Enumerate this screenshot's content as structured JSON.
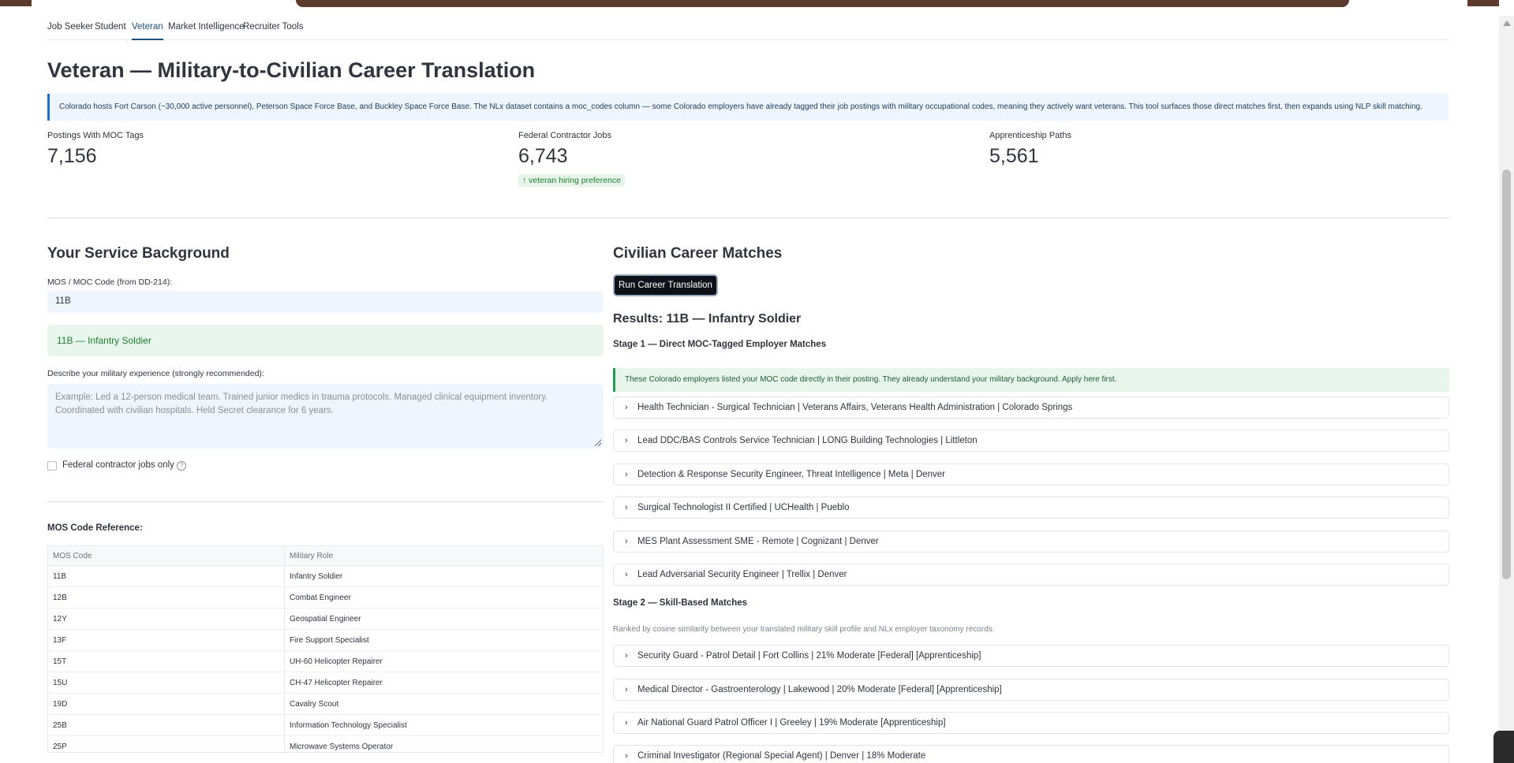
{
  "nav": {
    "tabs": [
      {
        "label": "Job Seeker"
      },
      {
        "label": "Student"
      },
      {
        "label": "Veteran",
        "active": true
      },
      {
        "label": "Market Intelligence"
      },
      {
        "label": "Recruiter Tools"
      }
    ]
  },
  "page": {
    "title": "Veteran — Military-to-Civilian Career Translation",
    "info": "Colorado hosts Fort Carson (~30,000 active personnel), Peterson Space Force Base, and Buckley Space Force Base. The NLx dataset contains a moc_codes column — some Colorado employers have already tagged their job postings with military occupational codes, meaning they actively want veterans. This tool surfaces those direct matches first, then expands using NLP skill matching."
  },
  "metrics": [
    {
      "label": "Postings With MOC Tags",
      "value": "7,156"
    },
    {
      "label": "Federal Contractor Jobs",
      "value": "6,743",
      "delta": "↑ veteran hiring preference"
    },
    {
      "label": "Apprenticeship Paths",
      "value": "5,561"
    }
  ],
  "service": {
    "heading": "Your Service Background",
    "mos_label": "MOS / MOC Code (from DD-214):",
    "mos_value": "11B",
    "mos_match": "11B — Infantry Soldier",
    "experience_label": "Describe your military experience (strongly recommended):",
    "experience_placeholder": "Example: Led a 12-person medical team. Trained junior medics in trauma protocols. Managed clinical equipment inventory. Coordinated with civilian hospitals. Held Secret clearance for 6 years.",
    "federal_only_label": "Federal contractor jobs only",
    "help_glyph": "?"
  },
  "reference": {
    "heading": "MOS Code Reference:",
    "columns": [
      "MOS Code",
      "Military Role"
    ],
    "rows": [
      [
        "11B",
        "Infantry Soldier"
      ],
      [
        "12B",
        "Combat Engineer"
      ],
      [
        "12Y",
        "Geospatial Engineer"
      ],
      [
        "13F",
        "Fire Support Specialist"
      ],
      [
        "15T",
        "UH-60 Helicopter Repairer"
      ],
      [
        "15U",
        "CH-47 Helicopter Repairer"
      ],
      [
        "19D",
        "Cavalry Scout"
      ],
      [
        "25B",
        "Information Technology Specialist"
      ],
      [
        "25P",
        "Microwave Systems Operator"
      ]
    ]
  },
  "matches": {
    "heading": "Civilian Career Matches",
    "run_button": "Run Career Translation",
    "results_title": "Results: 11B — Infantry Soldier",
    "stage1_title": "Stage 1 — Direct MOC-Tagged Employer Matches",
    "stage1_note": "These Colorado employers listed your MOC code directly in their posting. They already understand your military background. Apply here first.",
    "stage1_items": [
      "Health Technician - Surgical Technician | Veterans Affairs, Veterans Health Administration | Colorado Springs",
      "Lead DDC/BAS Controls Service Technician | LONG Building Technologies | Littleton",
      "Detection & Response Security Engineer, Threat Intelligence | Meta | Denver",
      "Surgical Technologist II Certified | UCHealth | Pueblo",
      "MES Plant Assessment SME - Remote | Cognizant | Denver",
      "Lead Adversarial Security Engineer | Trellix | Denver"
    ],
    "stage2_title": "Stage 2 — Skill-Based Matches",
    "stage2_caption": "Ranked by cosine similarity between your translated military skill profile and NLx employer taxonomy records.",
    "stage2_items": [
      "Security Guard - Patrol Detail | Fort Collins | 21% Moderate [Federal] [Apprenticeship]",
      "Medical Director - Gastroenterology | Lakewood | 20% Moderate [Federal] [Apprenticeship]",
      "Air National Guard Patrol Officer I | Greeley | 19% Moderate [Apprenticeship]",
      "Criminal Investigator (Regional Special Agent) | Denver | 18% Moderate"
    ]
  },
  "icons": {
    "chevron": "›"
  }
}
